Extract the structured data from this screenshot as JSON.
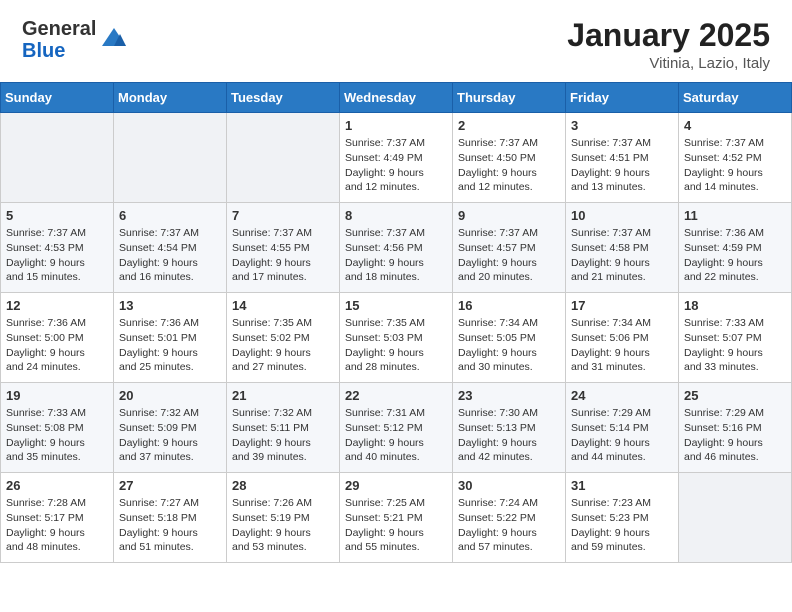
{
  "header": {
    "logo_general": "General",
    "logo_blue": "Blue",
    "month": "January 2025",
    "location": "Vitinia, Lazio, Italy"
  },
  "weekdays": [
    "Sunday",
    "Monday",
    "Tuesday",
    "Wednesday",
    "Thursday",
    "Friday",
    "Saturday"
  ],
  "weeks": [
    [
      {
        "day": "",
        "info": ""
      },
      {
        "day": "",
        "info": ""
      },
      {
        "day": "",
        "info": ""
      },
      {
        "day": "1",
        "info": "Sunrise: 7:37 AM\nSunset: 4:49 PM\nDaylight: 9 hours\nand 12 minutes."
      },
      {
        "day": "2",
        "info": "Sunrise: 7:37 AM\nSunset: 4:50 PM\nDaylight: 9 hours\nand 12 minutes."
      },
      {
        "day": "3",
        "info": "Sunrise: 7:37 AM\nSunset: 4:51 PM\nDaylight: 9 hours\nand 13 minutes."
      },
      {
        "day": "4",
        "info": "Sunrise: 7:37 AM\nSunset: 4:52 PM\nDaylight: 9 hours\nand 14 minutes."
      }
    ],
    [
      {
        "day": "5",
        "info": "Sunrise: 7:37 AM\nSunset: 4:53 PM\nDaylight: 9 hours\nand 15 minutes."
      },
      {
        "day": "6",
        "info": "Sunrise: 7:37 AM\nSunset: 4:54 PM\nDaylight: 9 hours\nand 16 minutes."
      },
      {
        "day": "7",
        "info": "Sunrise: 7:37 AM\nSunset: 4:55 PM\nDaylight: 9 hours\nand 17 minutes."
      },
      {
        "day": "8",
        "info": "Sunrise: 7:37 AM\nSunset: 4:56 PM\nDaylight: 9 hours\nand 18 minutes."
      },
      {
        "day": "9",
        "info": "Sunrise: 7:37 AM\nSunset: 4:57 PM\nDaylight: 9 hours\nand 20 minutes."
      },
      {
        "day": "10",
        "info": "Sunrise: 7:37 AM\nSunset: 4:58 PM\nDaylight: 9 hours\nand 21 minutes."
      },
      {
        "day": "11",
        "info": "Sunrise: 7:36 AM\nSunset: 4:59 PM\nDaylight: 9 hours\nand 22 minutes."
      }
    ],
    [
      {
        "day": "12",
        "info": "Sunrise: 7:36 AM\nSunset: 5:00 PM\nDaylight: 9 hours\nand 24 minutes."
      },
      {
        "day": "13",
        "info": "Sunrise: 7:36 AM\nSunset: 5:01 PM\nDaylight: 9 hours\nand 25 minutes."
      },
      {
        "day": "14",
        "info": "Sunrise: 7:35 AM\nSunset: 5:02 PM\nDaylight: 9 hours\nand 27 minutes."
      },
      {
        "day": "15",
        "info": "Sunrise: 7:35 AM\nSunset: 5:03 PM\nDaylight: 9 hours\nand 28 minutes."
      },
      {
        "day": "16",
        "info": "Sunrise: 7:34 AM\nSunset: 5:05 PM\nDaylight: 9 hours\nand 30 minutes."
      },
      {
        "day": "17",
        "info": "Sunrise: 7:34 AM\nSunset: 5:06 PM\nDaylight: 9 hours\nand 31 minutes."
      },
      {
        "day": "18",
        "info": "Sunrise: 7:33 AM\nSunset: 5:07 PM\nDaylight: 9 hours\nand 33 minutes."
      }
    ],
    [
      {
        "day": "19",
        "info": "Sunrise: 7:33 AM\nSunset: 5:08 PM\nDaylight: 9 hours\nand 35 minutes."
      },
      {
        "day": "20",
        "info": "Sunrise: 7:32 AM\nSunset: 5:09 PM\nDaylight: 9 hours\nand 37 minutes."
      },
      {
        "day": "21",
        "info": "Sunrise: 7:32 AM\nSunset: 5:11 PM\nDaylight: 9 hours\nand 39 minutes."
      },
      {
        "day": "22",
        "info": "Sunrise: 7:31 AM\nSunset: 5:12 PM\nDaylight: 9 hours\nand 40 minutes."
      },
      {
        "day": "23",
        "info": "Sunrise: 7:30 AM\nSunset: 5:13 PM\nDaylight: 9 hours\nand 42 minutes."
      },
      {
        "day": "24",
        "info": "Sunrise: 7:29 AM\nSunset: 5:14 PM\nDaylight: 9 hours\nand 44 minutes."
      },
      {
        "day": "25",
        "info": "Sunrise: 7:29 AM\nSunset: 5:16 PM\nDaylight: 9 hours\nand 46 minutes."
      }
    ],
    [
      {
        "day": "26",
        "info": "Sunrise: 7:28 AM\nSunset: 5:17 PM\nDaylight: 9 hours\nand 48 minutes."
      },
      {
        "day": "27",
        "info": "Sunrise: 7:27 AM\nSunset: 5:18 PM\nDaylight: 9 hours\nand 51 minutes."
      },
      {
        "day": "28",
        "info": "Sunrise: 7:26 AM\nSunset: 5:19 PM\nDaylight: 9 hours\nand 53 minutes."
      },
      {
        "day": "29",
        "info": "Sunrise: 7:25 AM\nSunset: 5:21 PM\nDaylight: 9 hours\nand 55 minutes."
      },
      {
        "day": "30",
        "info": "Sunrise: 7:24 AM\nSunset: 5:22 PM\nDaylight: 9 hours\nand 57 minutes."
      },
      {
        "day": "31",
        "info": "Sunrise: 7:23 AM\nSunset: 5:23 PM\nDaylight: 9 hours\nand 59 minutes."
      },
      {
        "day": "",
        "info": ""
      }
    ]
  ]
}
